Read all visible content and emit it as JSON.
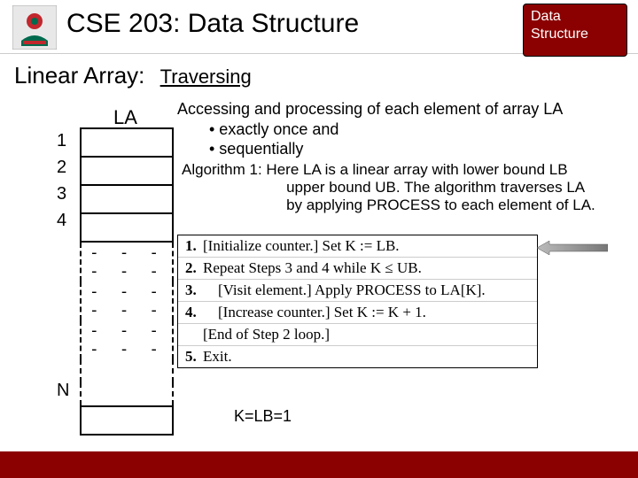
{
  "header": {
    "title": "CSE 203: Data Structure",
    "badge_l1": "Data",
    "badge_l2": "Structure"
  },
  "subheader": {
    "label": "Linear Array:",
    "topic": "Traversing"
  },
  "la": {
    "heading": "LA",
    "indices": [
      "1",
      "2",
      "3",
      "4"
    ],
    "last_index": "N",
    "dash_row": "- - - - - -"
  },
  "description": {
    "line1": "Accessing and processing of each element of array LA",
    "b1": "• exactly once and",
    "b2": "• sequentially"
  },
  "algorithm_intro": {
    "l1": "Algorithm 1: Here LA is a linear array with lower bound LB",
    "l2": "                         upper bound UB. The algorithm traverses LA",
    "l3": "                         by applying PROCESS to each element of LA."
  },
  "algorithm_steps": [
    {
      "n": "1.",
      "t": "[Initialize counter.] Set K := LB."
    },
    {
      "n": "2.",
      "t": "Repeat Steps 3 and 4 while K ≤ UB."
    },
    {
      "n": "3.",
      "t": "    [Visit element.] Apply PROCESS to LA[K]."
    },
    {
      "n": "4.",
      "t": "    [Increase counter.] Set K := K + 1."
    },
    {
      "n": "",
      "t": "[End of Step 2 loop.]"
    },
    {
      "n": "5.",
      "t": "Exit."
    }
  ],
  "k_state": "K=LB=1"
}
